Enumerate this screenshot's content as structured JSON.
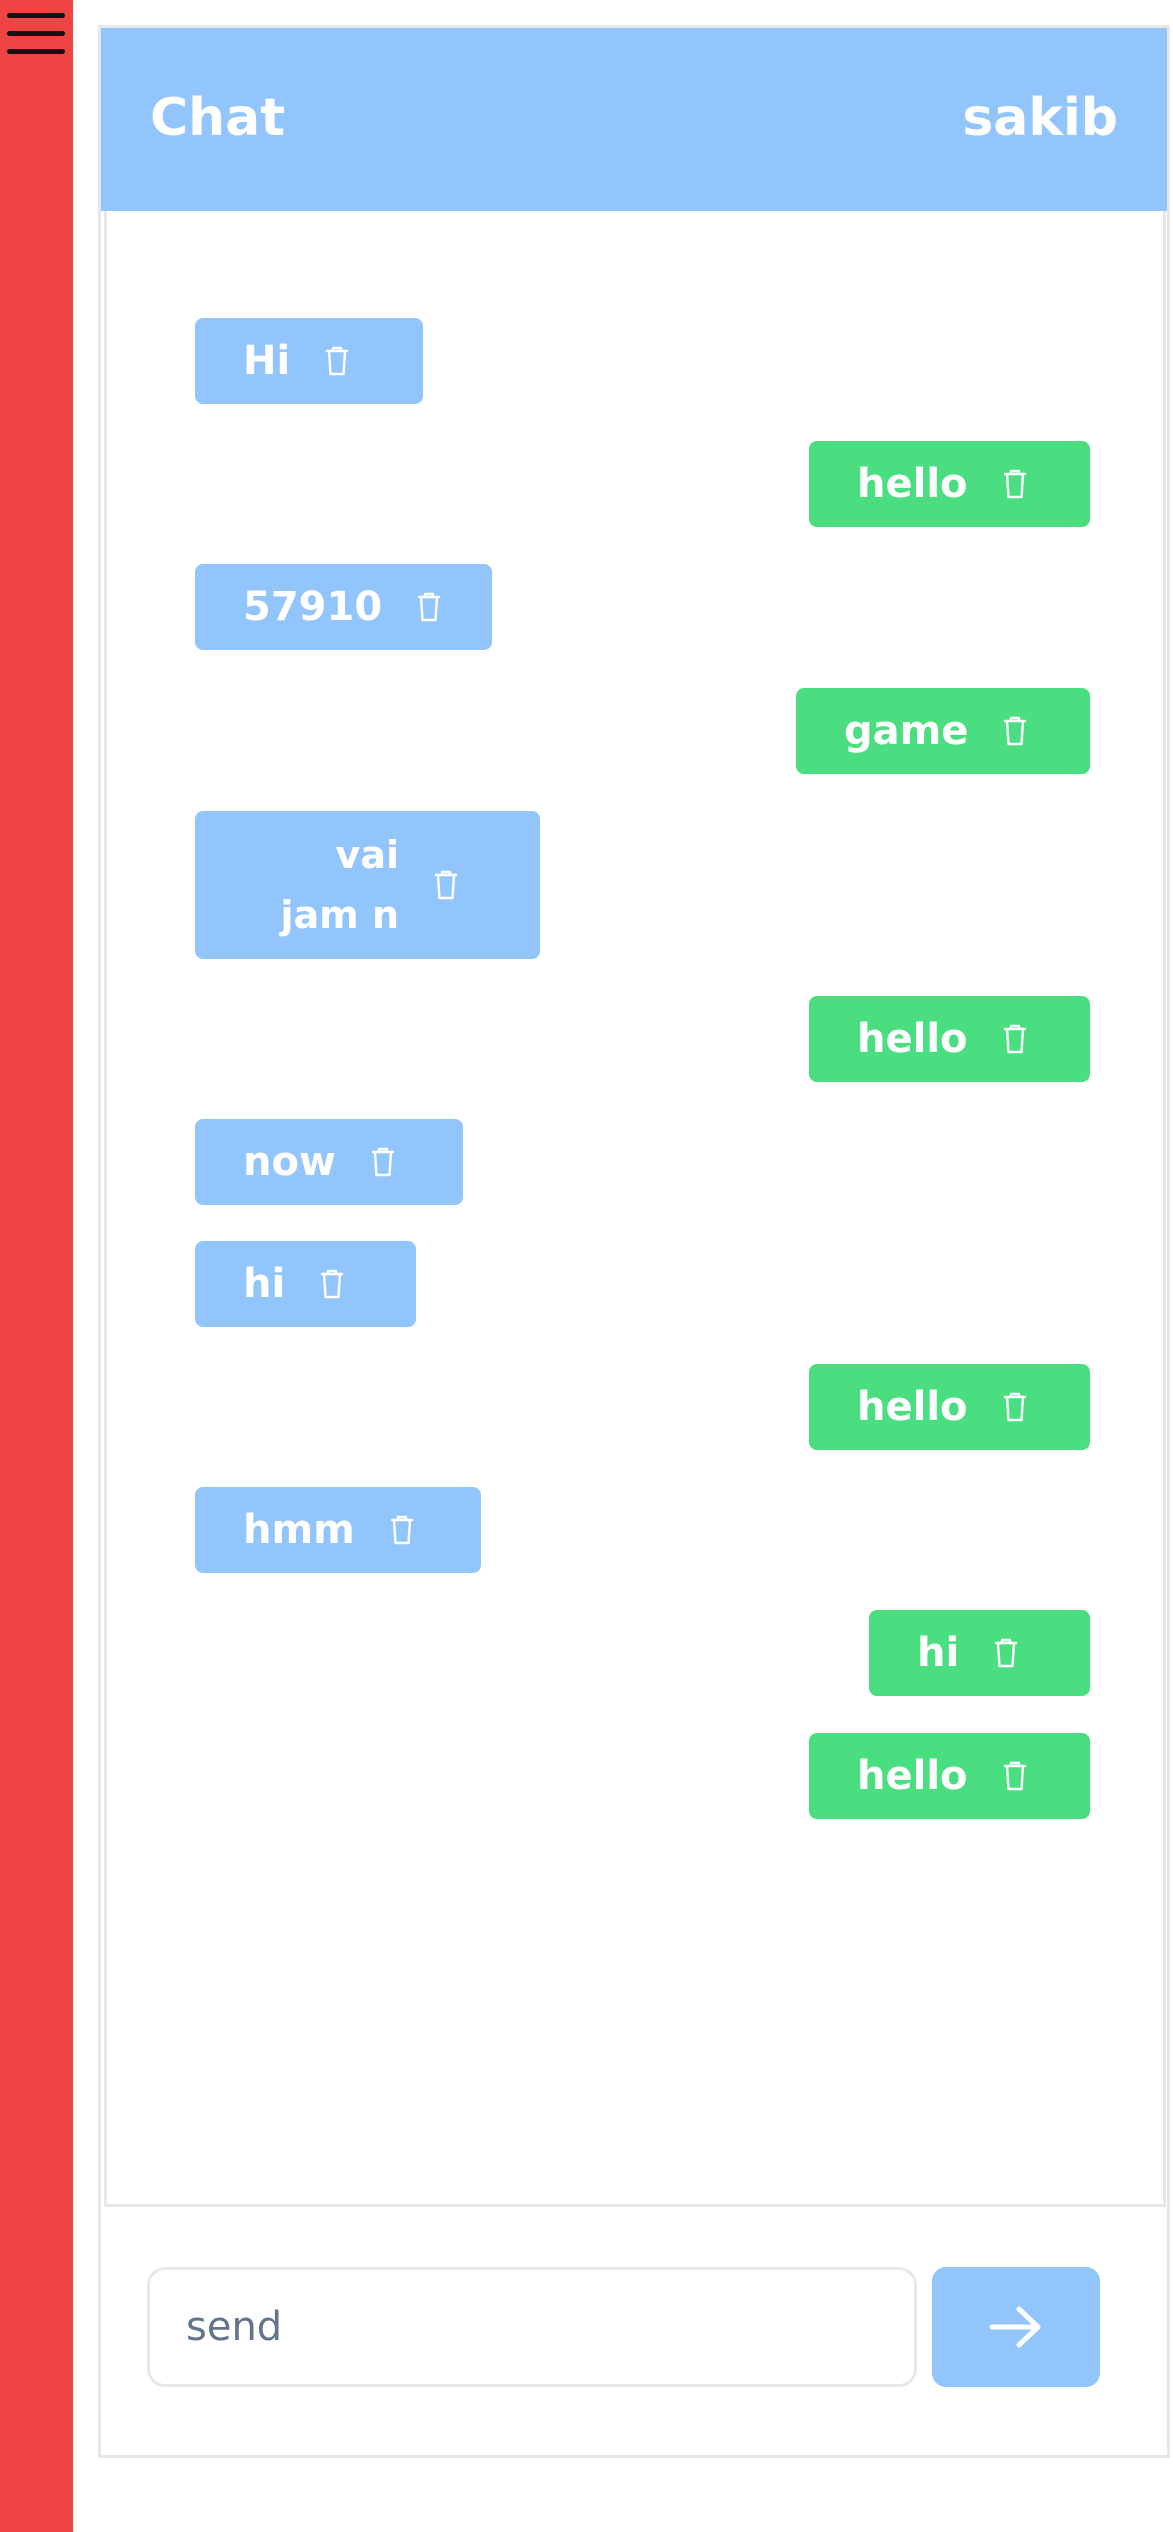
{
  "header": {
    "title": "Chat",
    "user": "sakib"
  },
  "messages": [
    {
      "text": "Hi",
      "side": "left"
    },
    {
      "text": "hello",
      "side": "right"
    },
    {
      "text": "57910",
      "side": "left"
    },
    {
      "text": "game",
      "side": "right"
    },
    {
      "text": "vai jam n",
      "side": "left"
    },
    {
      "text": "hello",
      "side": "right"
    },
    {
      "text": "now",
      "side": "left"
    },
    {
      "text": "hi",
      "side": "left"
    },
    {
      "text": "hello",
      "side": "right"
    },
    {
      "text": "hmm",
      "side": "left"
    },
    {
      "text": "hi",
      "side": "right"
    },
    {
      "text": "hello",
      "side": "right"
    }
  ],
  "composer": {
    "placeholder": "send"
  },
  "colors": {
    "sidebar": "#ef4444",
    "header": "#93c5fd",
    "incoming_bubble": "#93c5fd",
    "outgoing_bubble": "#4ade80"
  },
  "icons": {
    "menu": "hamburger-icon",
    "delete": "trash-icon",
    "send": "arrow-right-icon"
  }
}
